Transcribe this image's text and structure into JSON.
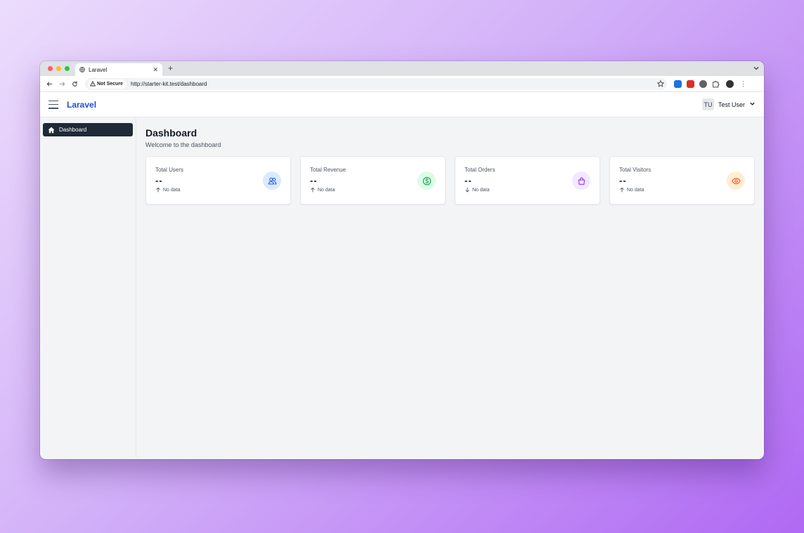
{
  "browser": {
    "tab_title": "Laravel",
    "new_tab": "+",
    "security_label": "Not Secure",
    "url": "http://starter-kit.test/dashboard"
  },
  "header": {
    "brand": "Laravel",
    "user_initials": "TU",
    "user_name": "Test User"
  },
  "sidebar": {
    "items": [
      {
        "label": "Dashboard",
        "icon": "home-icon",
        "active": true
      }
    ]
  },
  "main": {
    "title": "Dashboard",
    "subtitle": "Welcome to the dashboard",
    "cards": [
      {
        "label": "Total Users",
        "value": "--",
        "trend": "No data",
        "trend_dir": "up",
        "icon": "users-icon",
        "icon_color": "#2563eb",
        "icon_bg": "#dbeafe"
      },
      {
        "label": "Total Revenue",
        "value": "--",
        "trend": "No data",
        "trend_dir": "up",
        "icon": "dollar-icon",
        "icon_color": "#16a34a",
        "icon_bg": "#dcfce7"
      },
      {
        "label": "Total Orders",
        "value": "--",
        "trend": "No data",
        "trend_dir": "down",
        "icon": "shopping-bag-icon",
        "icon_color": "#9333ea",
        "icon_bg": "#f3e8ff"
      },
      {
        "label": "Total Visitors",
        "value": "--",
        "trend": "No data",
        "trend_dir": "up",
        "icon": "eye-icon",
        "icon_color": "#ea580c",
        "icon_bg": "#ffedd5"
      }
    ]
  }
}
